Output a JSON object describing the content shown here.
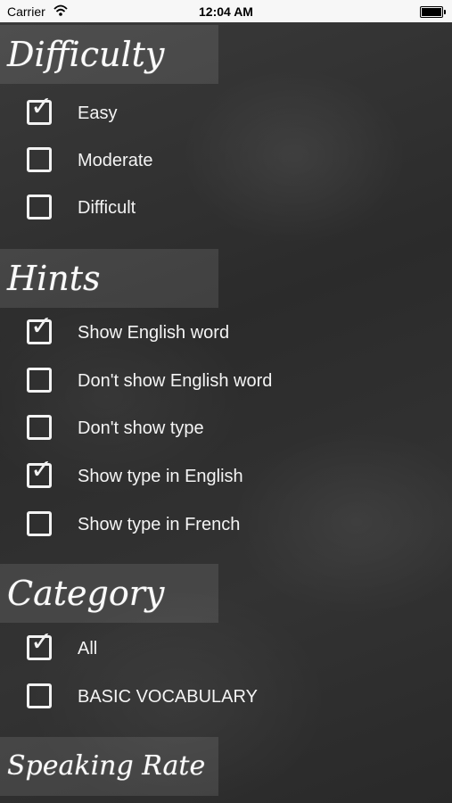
{
  "status_bar": {
    "carrier": "Carrier",
    "time": "12:04 AM"
  },
  "sections": {
    "difficulty": {
      "title": "Difficulty",
      "options": [
        {
          "label": "Easy",
          "checked": true
        },
        {
          "label": "Moderate",
          "checked": false
        },
        {
          "label": "Difficult",
          "checked": false
        }
      ]
    },
    "hints": {
      "title": "Hints",
      "options": [
        {
          "label": "Show English word",
          "checked": true
        },
        {
          "label": "Don't show English word",
          "checked": false
        },
        {
          "label": "Don't show type",
          "checked": false
        },
        {
          "label": "Show type in English",
          "checked": true
        },
        {
          "label": "Show type in French",
          "checked": false
        }
      ]
    },
    "category": {
      "title": "Category",
      "options": [
        {
          "label": "All",
          "checked": true
        },
        {
          "label": "BASIC VOCABULARY",
          "checked": false
        }
      ]
    },
    "speaking_rate": {
      "title": "Speaking Rate"
    }
  },
  "icons": {
    "check_mark": "✓"
  },
  "colors": {
    "board": "#2d2d2d",
    "chalk": "#f4f4f4",
    "status_bar": "#f7f7f7"
  }
}
